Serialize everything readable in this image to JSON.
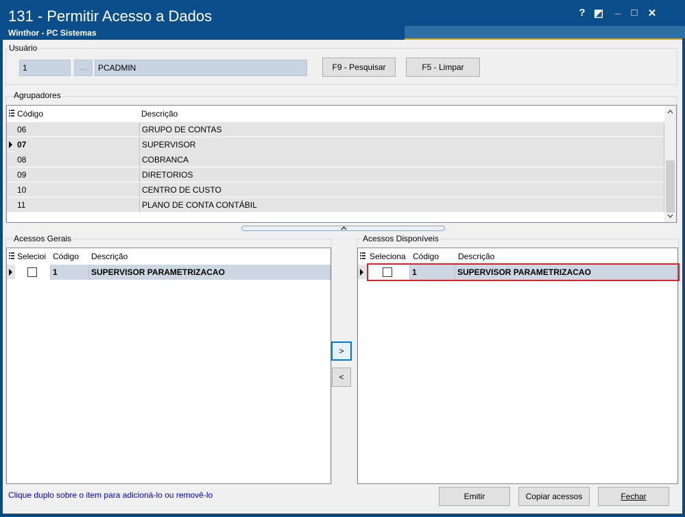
{
  "window": {
    "title": "131 - Permitir Acesso a Dados",
    "subtitle": "Winthor - PC Sistemas",
    "controls": [
      "?",
      "◩",
      "_",
      "□",
      "✕"
    ]
  },
  "usuario": {
    "group_label": "Usuário",
    "code": "1",
    "ellipsis": "...",
    "name": "PCADMIN",
    "btn_search": "F9 - Pesquisar",
    "btn_clear": "F5 - Limpar"
  },
  "agrupadores": {
    "group_label": "Agrupadores",
    "columns": [
      "Código",
      "Descrição"
    ],
    "rows": [
      {
        "code": "06",
        "desc": "GRUPO DE CONTAS"
      },
      {
        "code": "07",
        "desc": "SUPERVISOR",
        "selected": true
      },
      {
        "code": "08",
        "desc": "COBRANCA"
      },
      {
        "code": "09",
        "desc": "DIRETORIOS"
      },
      {
        "code": "10",
        "desc": "CENTRO DE CUSTO"
      },
      {
        "code": "11",
        "desc": "PLANO DE CONTA CONTÁBIL"
      }
    ]
  },
  "acessos_gerais": {
    "group_label": "Acessos Gerais",
    "columns": [
      "Selecioi",
      "Código",
      "Descrição"
    ],
    "rows": [
      {
        "code": "1",
        "desc": "SUPERVISOR PARAMETRIZACAO"
      }
    ]
  },
  "acessos_disponiveis": {
    "group_label": "Acessos Disponíveis",
    "columns": [
      "Seleciona",
      "Código",
      "Descrição"
    ],
    "rows": [
      {
        "code": "1",
        "desc": "SUPERVISOR PARAMETRIZACAO"
      }
    ]
  },
  "transfer": {
    "add": ">",
    "remove": "<"
  },
  "footer": {
    "hint": "Clique duplo sobre o item para adicioná-lo ou removê-lo",
    "btn_emitir": "Emitir",
    "btn_copiar": "Copiar acessos",
    "btn_fechar": "Fechar"
  },
  "colors": {
    "title_bar": "#0a4f8c",
    "accent_border": "#d4a82a",
    "highlight": "#e02020",
    "hint_text": "#0000c8"
  }
}
